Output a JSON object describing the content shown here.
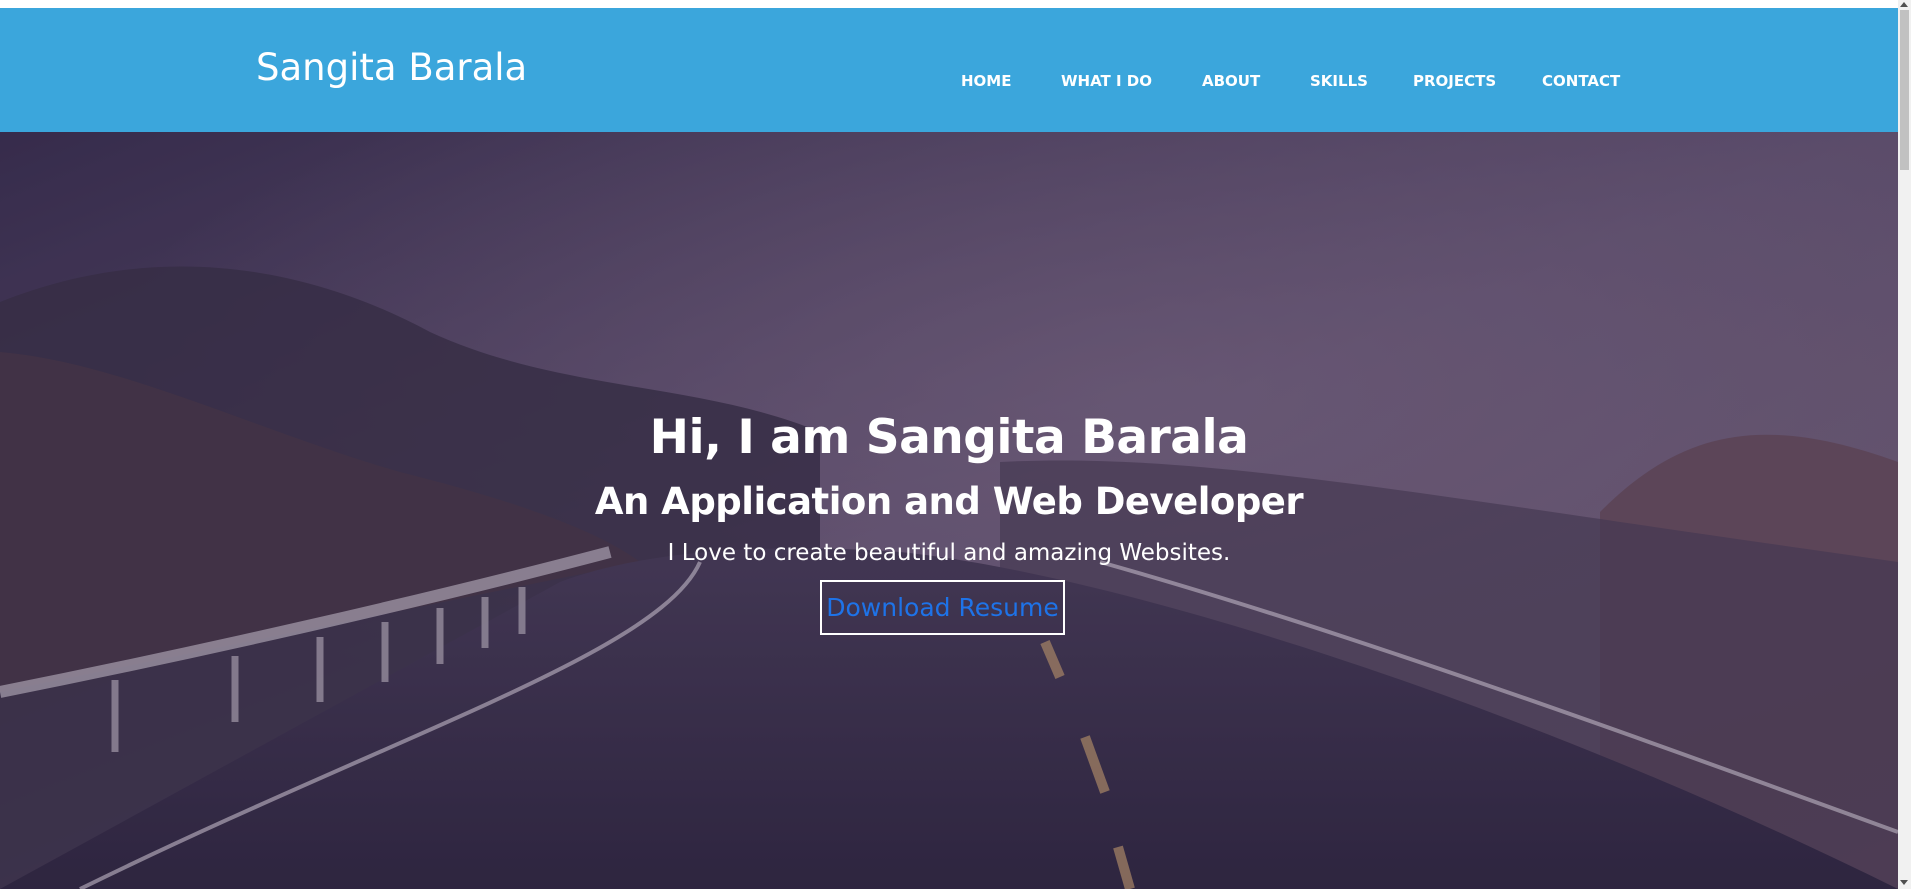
{
  "navbar": {
    "brand": "Sangita Barala",
    "items": [
      {
        "label": "HOME"
      },
      {
        "label": "WHAT I DO"
      },
      {
        "label": "ABOUT"
      },
      {
        "label": "SKILLS"
      },
      {
        "label": "PROJECTS"
      },
      {
        "label": "CONTACT"
      }
    ],
    "background": "#3ba6dc"
  },
  "hero": {
    "title": "Hi, I am Sangita Barala",
    "subtitle": "An Application and Web Developer",
    "tagline": "I Love to create beautiful and amazing Websites.",
    "cta_label": "Download Resume",
    "cta_color": "#1e73e8"
  }
}
